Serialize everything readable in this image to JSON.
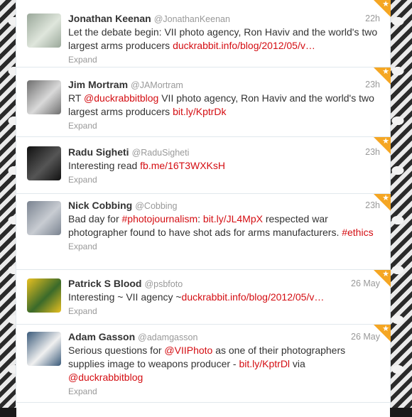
{
  "tweets": [
    {
      "name": "Jonathan Keenan",
      "handle": "@JonathanKeenan",
      "time": "22h",
      "text": [
        {
          "t": "Let the debate begin: VII photo agency, Ron Haviv and the world's two largest arms producers ",
          "link": false
        },
        {
          "t": "duckrabbit.info/blog/2012/05/v…",
          "link": true
        }
      ],
      "expand": "Expand",
      "avatar_colors": [
        "#9aa89a",
        "#dfe6dc"
      ],
      "favorited": true
    },
    {
      "name": "Jim Mortram",
      "handle": "@JAMortram",
      "time": "23h",
      "text": [
        {
          "t": "RT ",
          "link": false
        },
        {
          "t": "@duckrabbitblog",
          "link": true
        },
        {
          "t": " VII photo agency, Ron Haviv and the world's two largest arms producers ",
          "link": false
        },
        {
          "t": "bit.ly/KptrDk",
          "link": true
        }
      ],
      "expand": "Expand",
      "avatar_colors": [
        "#6e6e6e",
        "#d9d9d9"
      ],
      "favorited": true
    },
    {
      "name": "Radu Sigheti",
      "handle": "@RaduSigheti",
      "time": "23h",
      "text": [
        {
          "t": "Interesting read ",
          "link": false
        },
        {
          "t": "fb.me/16T3WXKsH",
          "link": true
        }
      ],
      "expand": "Expand",
      "avatar_colors": [
        "#111111",
        "#555555"
      ],
      "favorited": true
    },
    {
      "name": "Nick Cobbing",
      "handle": "@Cobbing",
      "time": "23h",
      "text": [
        {
          "t": "Bad day for ",
          "link": false
        },
        {
          "t": "#photojournalism",
          "link": true
        },
        {
          "t": ": ",
          "link": false
        },
        {
          "t": "bit.ly/JL4MpX",
          "link": true
        },
        {
          "t": " respected war photographer found to have shot ads for arms manufacturers. ",
          "link": false
        },
        {
          "t": "#ethics",
          "link": true
        }
      ],
      "expand": "Expand",
      "avatar_colors": [
        "#7a8390",
        "#c8ccd2"
      ],
      "favorited": true
    },
    {
      "name": "Patrick S Blood",
      "handle": "@psbfoto",
      "time": "26 May",
      "text": [
        {
          "t": "Interesting ~ VII agency ~",
          "link": false
        },
        {
          "t": "duckrabbit.info/blog/2012/05/v…",
          "link": true
        }
      ],
      "expand": "Expand",
      "avatar_colors": [
        "#e8c020",
        "#3a6a2a"
      ],
      "favorited": true
    },
    {
      "name": "Adam Gasson",
      "handle": "@adamgasson",
      "time": "26 May",
      "text": [
        {
          "t": "Serious questions for ",
          "link": false
        },
        {
          "t": "@VIIPhoto",
          "link": true
        },
        {
          "t": " as one of their photographers supplies image to weapons producer - ",
          "link": false
        },
        {
          "t": "bit.ly/KptrDl",
          "link": true
        },
        {
          "t": " via ",
          "link": false
        },
        {
          "t": "@duckrabbitblog",
          "link": true
        }
      ],
      "expand": "Expand",
      "avatar_colors": [
        "#3a5a7a",
        "#f0f0f0"
      ],
      "favorited": true
    }
  ],
  "icons": {
    "favorite": "star-icon"
  },
  "colors": {
    "link": "#d40d12",
    "favorite": "#f5a623",
    "name": "#333333",
    "meta": "#999999"
  }
}
